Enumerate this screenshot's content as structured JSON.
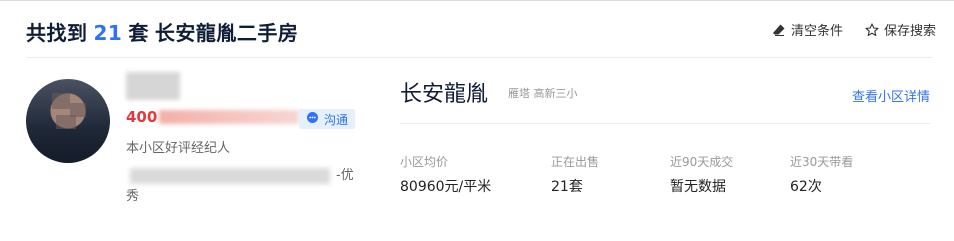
{
  "header": {
    "prefix": "共找到",
    "count": "21",
    "unit": "套",
    "community": "长安龍胤二手房",
    "actions": {
      "clear_label": "清空条件",
      "save_label": "保存搜索"
    }
  },
  "agent": {
    "phone_visible": "400",
    "chat_label": "沟通",
    "description": "本小区好评经纪人",
    "badge_tail": "-优",
    "badge_tail_line2": "秀"
  },
  "community": {
    "name": "长安龍胤",
    "area": "雁塔 高新三小",
    "detail_link": "查看小区详情",
    "stats": [
      {
        "label": "小区均价",
        "value": "80960元/平米"
      },
      {
        "label": "正在出售",
        "value": "21套"
      },
      {
        "label": "近90天成交",
        "value": "暂无数据"
      },
      {
        "label": "近30天带看",
        "value": "62次"
      }
    ]
  },
  "colors": {
    "accent": "#3072f6",
    "phone": "#e4393c",
    "title": "#101d37"
  }
}
